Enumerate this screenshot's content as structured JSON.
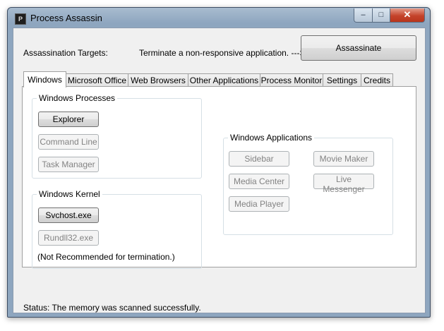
{
  "window": {
    "title": "Process Assassin",
    "icon_letter": "P",
    "controls": {
      "minimize": "–",
      "maximize": "□",
      "close": "✕"
    }
  },
  "header": {
    "targets_label": "Assassination Targets:",
    "hint": "Terminate a non-responsive application.  --->",
    "assassinate_label": "Assassinate"
  },
  "tabs": [
    {
      "label": "Windows"
    },
    {
      "label": "Microsoft Office"
    },
    {
      "label": "Web Browsers"
    },
    {
      "label": "Other Applications"
    },
    {
      "label": "Process Monitor"
    },
    {
      "label": "Settings"
    },
    {
      "label": "Credits"
    }
  ],
  "windows_processes": {
    "title": "Windows Processes",
    "buttons": [
      "Explorer",
      "Command Line",
      "Task Manager"
    ]
  },
  "windows_kernel": {
    "title": "Windows Kernel",
    "buttons": [
      "Svchost.exe",
      "Rundll32.exe"
    ],
    "note": "(Not Recommended for termination.)"
  },
  "windows_applications": {
    "title": "Windows Applications",
    "buttons": [
      "Sidebar",
      "Movie Maker",
      "Media Center",
      "Live Messenger",
      "Media Player"
    ]
  },
  "status": "Status: The memory was scanned successfully."
}
